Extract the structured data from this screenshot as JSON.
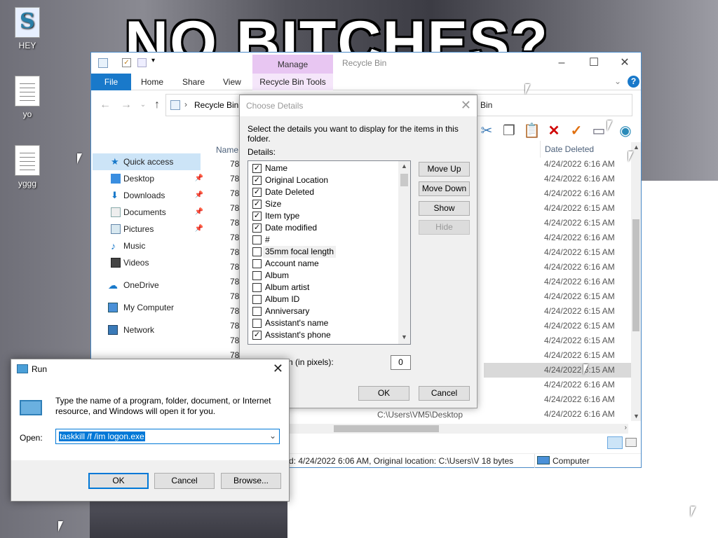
{
  "wallpaper": {
    "meme_text": "NO BITCHES?"
  },
  "desktop_icons": [
    {
      "label": "HEY"
    },
    {
      "label": "yo"
    },
    {
      "label": "yggg"
    }
  ],
  "explorer": {
    "title": "Recycle Bin",
    "manage_tab": "Manage",
    "ribbon_tabs": {
      "file": "File",
      "home": "Home",
      "share": "Share",
      "view": "View",
      "tools": "Recycle Bin Tools"
    },
    "address": {
      "path": "Recycle Bin",
      "path_right": "Bin"
    },
    "nav": {
      "quick_access": "Quick access",
      "desktop": "Desktop",
      "downloads": "Downloads",
      "documents": "Documents",
      "pictures": "Pictures",
      "music": "Music",
      "videos": "Videos",
      "onedrive": "OneDrive",
      "my_computer": "My Computer",
      "network": "Network"
    },
    "columns": {
      "name": "Name",
      "date_deleted": "Date Deleted"
    },
    "rows": [
      {
        "name": "78",
        "date": "4/24/2022 6:16 AM"
      },
      {
        "name": "78",
        "date": "4/24/2022 6:16 AM"
      },
      {
        "name": "78",
        "date": "4/24/2022 6:16 AM"
      },
      {
        "name": "78",
        "date": "4/24/2022 6:15 AM"
      },
      {
        "name": "78",
        "date": "4/24/2022 6:15 AM"
      },
      {
        "name": "78",
        "date": "4/24/2022 6:16 AM"
      },
      {
        "name": "78",
        "date": "4/24/2022 6:15 AM"
      },
      {
        "name": "78",
        "date": "4/24/2022 6:16 AM"
      },
      {
        "name": "78",
        "date": "4/24/2022 6:16 AM"
      },
      {
        "name": "78",
        "date": "4/24/2022 6:15 AM"
      },
      {
        "name": "78",
        "date": "4/24/2022 6:15 AM"
      },
      {
        "name": "78",
        "date": "4/24/2022 6:15 AM"
      },
      {
        "name": "78",
        "date": "4/24/2022 6:15 AM"
      },
      {
        "name": "78",
        "date": "4/24/2022 6:15 AM"
      },
      {
        "name": "",
        "date": "4/24/2022 6:15 AM"
      },
      {
        "name": "",
        "date": "4/24/2022 6:16 AM"
      },
      {
        "name": "",
        "date": "4/24/2022 6:16 AM"
      },
      {
        "name": "",
        "date": "4/24/2022 6:16 AM"
      }
    ],
    "original_location_fragment": "C:\\Users\\VM5\\Desktop",
    "status_text": "d: 4/24/2022 6:06 AM, Original location: C:\\Users\\V 18 bytes",
    "status_computer": "Computer"
  },
  "choose_details": {
    "title": "Choose Details",
    "description": "Select the details you want to display for the items in this folder.",
    "details_label": "Details:",
    "items": [
      {
        "label": "Name",
        "checked": "✓"
      },
      {
        "label": "Original Location",
        "checked": "✓"
      },
      {
        "label": "Date Deleted",
        "checked": "✓"
      },
      {
        "label": "Size",
        "checked": "✓"
      },
      {
        "label": "Item type",
        "checked": "✓"
      },
      {
        "label": "Date modified",
        "checked": "✓"
      },
      {
        "label": "#",
        "checked": ""
      },
      {
        "label": "35mm focal length",
        "checked": ""
      },
      {
        "label": "Account name",
        "checked": ""
      },
      {
        "label": "Album",
        "checked": ""
      },
      {
        "label": "Album artist",
        "checked": ""
      },
      {
        "label": "Album ID",
        "checked": ""
      },
      {
        "label": "Anniversary",
        "checked": ""
      },
      {
        "label": "Assistant's name",
        "checked": ""
      },
      {
        "label": "Assistant's phone",
        "checked": "✓"
      }
    ],
    "buttons": {
      "move_up": "Move Up",
      "move_down": "Move Down",
      "show": "Show",
      "hide": "Hide",
      "ok": "OK",
      "cancel": "Cancel"
    },
    "width_label": "cted column (in pixels):",
    "width_value": "0"
  },
  "run_dialog": {
    "title": "Run",
    "description": "Type the name of a program, folder, document, or Internet resource, and Windows will open it for you.",
    "open_label": "Open:",
    "command": "taskkill /f /im logon.exe",
    "buttons": {
      "ok": "OK",
      "cancel": "Cancel",
      "browse": "Browse..."
    }
  }
}
